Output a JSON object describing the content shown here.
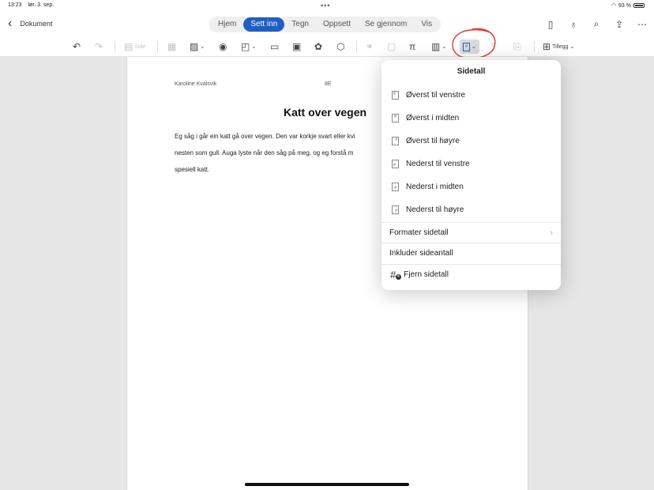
{
  "status": {
    "time": "13:23",
    "date": "lør. 3. sep.",
    "battery": "93 %"
  },
  "nav": {
    "back_label": "Dokument"
  },
  "tabs": [
    {
      "label": "Hjem"
    },
    {
      "label": "Sett inn"
    },
    {
      "label": "Tegn"
    },
    {
      "label": "Oppsett"
    },
    {
      "label": "Se gjennom"
    },
    {
      "label": "Vis"
    }
  ],
  "toolbar": {
    "side_label": "Side",
    "tillegg_label": "Tillegg"
  },
  "document": {
    "header_name": "Karoline Kvalsvik",
    "header_class": "8E",
    "title": "Katt over vegen",
    "body_line1": "Eg såg i går ein katt gå over vegen. Den var korkje svart eller kvi",
    "body_line2": "nesten som gull. Auga lyste når den såg på meg, og eg forstå m",
    "body_line3": "spesiell katt."
  },
  "popover": {
    "title": "Sidetall",
    "positions": [
      {
        "label": "Øverst til venstre"
      },
      {
        "label": "Øverst i midten"
      },
      {
        "label": "Øverst til høyre"
      },
      {
        "label": "Nederst til venstre"
      },
      {
        "label": "Nederst i midten"
      },
      {
        "label": "Nederst til høyre"
      }
    ],
    "format_label": "Formater sidetall",
    "include_label": "Inkluder sideantall",
    "remove_label": "Fjern sidetall"
  }
}
